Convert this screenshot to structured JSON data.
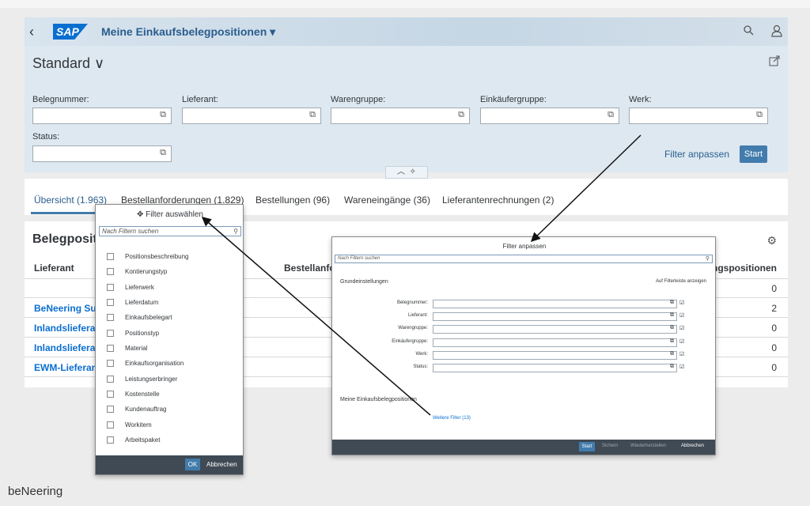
{
  "shell": {
    "title": "Meine Einkaufsbelegpositionen ▾",
    "logo": "SAP",
    "back_icon": "‹",
    "search_icon": "search-icon",
    "user_icon": "user-icon"
  },
  "header": {
    "variant": "Standard ∨",
    "filters": [
      {
        "label": "Belegnummer:"
      },
      {
        "label": "Lieferant:"
      },
      {
        "label": "Warengruppe:"
      },
      {
        "label": "Einkäufergruppe:"
      },
      {
        "label": "Werk:"
      },
      {
        "label": "Status:"
      }
    ],
    "filter_adjust": "Filter anpassen",
    "start": "Start"
  },
  "tabs": [
    "Übersicht (1.963)",
    "Bestellanforderungen (1.829)",
    "Bestellungen (96)",
    "Wareneingänge (36)",
    "Lieferantenrechnungen (2)"
  ],
  "table": {
    "title": "Belegpositio",
    "col_lieferant": "Lieferant",
    "col_bestell": "Bestellanfor",
    "col_right": "nungspositionen",
    "rows": [
      {
        "lieferant": "",
        "value": "0"
      },
      {
        "lieferant": "BeNeering Supp",
        "value": "2"
      },
      {
        "lieferant": "Inlandslieferant",
        "value": "0"
      },
      {
        "lieferant": "Inlandslieferant",
        "value": "0"
      },
      {
        "lieferant": "EWM-Lieferant (",
        "value": "0"
      }
    ]
  },
  "popup_select": {
    "title": "Filter auswählen",
    "search_placeholder": "Nach Filtern suchen",
    "items": [
      "Positionsbeschreibung",
      "Kontierungstyp",
      "Lieferwerk",
      "Lieferdatum",
      "Einkaufsbelegart",
      "Positionstyp",
      "Material",
      "Einkaufsorganisation",
      "Leistungserbringer",
      "Kostenstelle",
      "Kundenauftrag",
      "Workitem",
      "Arbeitspaket"
    ],
    "ok": "OK",
    "cancel": "Abbrechen"
  },
  "popup_adjust": {
    "title": "Filter anpassen",
    "search_placeholder": "Nach Filtern suchen",
    "section_basic": "Grundeinstellungen",
    "show_in_bar": "Auf Filterleiste anzeigen",
    "rows": [
      "Belegnummer:",
      "Lieferant:",
      "Warengruppe:",
      "Einkäufergruppe:",
      "Werk:",
      "Status:"
    ],
    "section_app": "Meine Einkaufsbelegpositionen",
    "more_filters": "Weitere Filter (13)",
    "buttons": {
      "start": "Start",
      "save": "Sichern",
      "restore": "Wiederherstellen",
      "cancel": "Abbrechen"
    }
  },
  "brand": "beNeering"
}
